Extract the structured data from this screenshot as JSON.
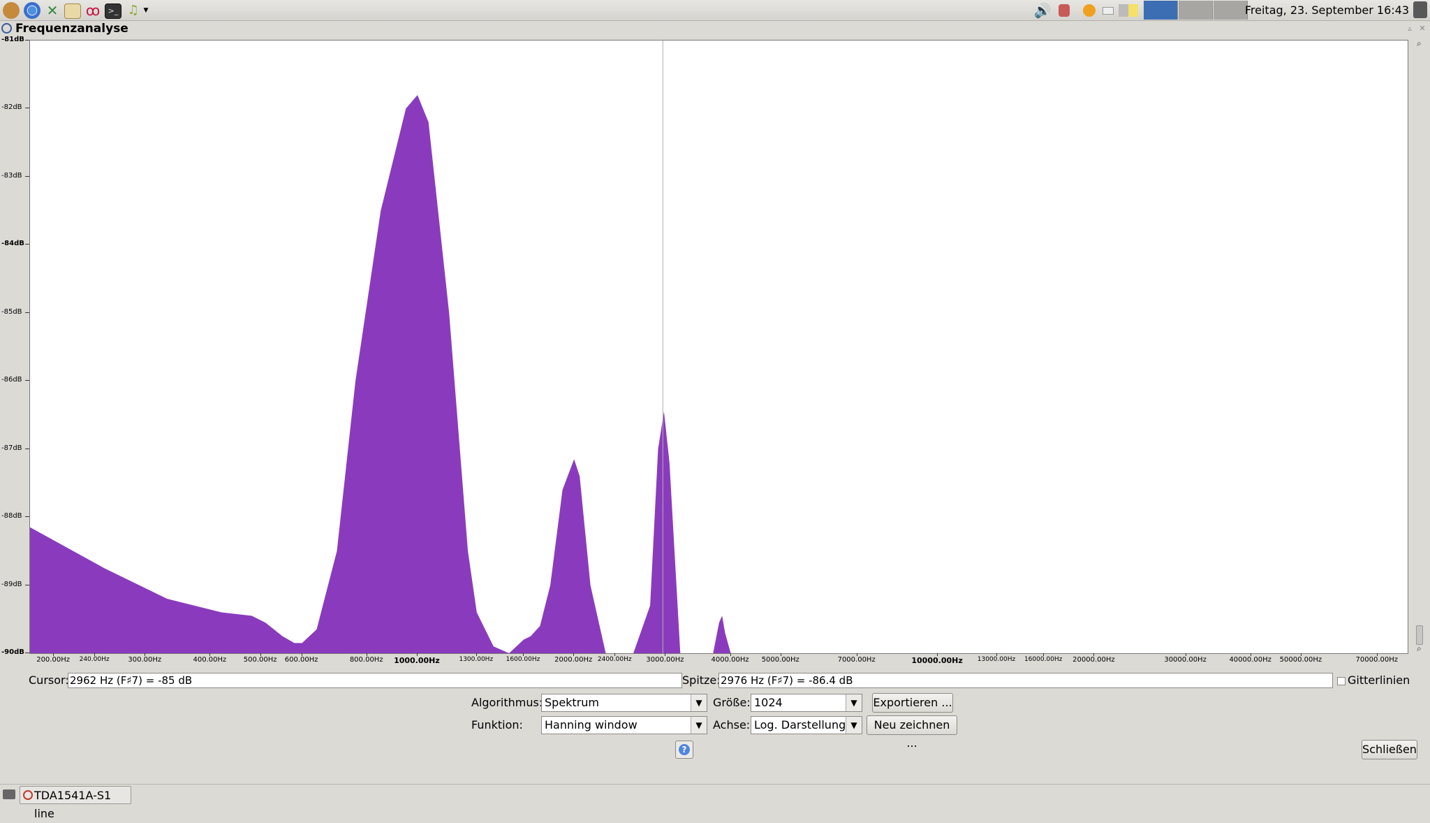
{
  "top_panel": {
    "launchers": [
      "monkey-app-icon",
      "chromium-icon",
      "tools-icon",
      "text-editor-icon",
      "debian-icon",
      "terminal-icon",
      "music-icon"
    ],
    "clock": "Freitag, 23. September 16:43"
  },
  "window": {
    "title": "Frequenzanalyse"
  },
  "chart_data": {
    "type": "area",
    "color": "#8a3bbd",
    "x_scale": "log",
    "xlim": [
      180,
      80000
    ],
    "ylim": [
      -90,
      -81
    ],
    "y_ticks": [
      "-81dB",
      "-82dB",
      "-83dB",
      "-84dB",
      "-85dB",
      "-86dB",
      "-87dB",
      "-88dB",
      "-89dB",
      "-90dB"
    ],
    "x_ticks": [
      "200.00Hz",
      "240.00Hz",
      "300.00Hz",
      "400.00Hz",
      "500.00Hz",
      "600.00Hz",
      "800.00Hz",
      "1000.00Hz",
      "1300.00Hz",
      "1600.00Hz",
      "2000.00Hz",
      "2400.00Hz",
      "3000.00Hz",
      "4000.00Hz",
      "5000.00Hz",
      "7000.00Hz",
      "10000.00Hz",
      "13000.00Hz",
      "16000.00Hz",
      "20000.00Hz",
      "30000.00Hz",
      "40000.00Hz",
      "50000.00Hz",
      "70000.00Hz"
    ],
    "x": [
      180,
      250,
      330,
      420,
      480,
      510,
      550,
      580,
      600,
      640,
      700,
      760,
      850,
      950,
      1000,
      1050,
      1150,
      1250,
      1300,
      1400,
      1500,
      1600,
      1650,
      1720,
      1800,
      1900,
      2000,
      2050,
      2150,
      2300,
      2400,
      2600,
      2800,
      2900,
      2976,
      3050,
      3200,
      3300,
      3500,
      3700,
      3800,
      3850,
      3900,
      4000,
      80000
    ],
    "y": [
      -88.15,
      -88.75,
      -89.2,
      -89.4,
      -89.45,
      -89.55,
      -89.75,
      -89.85,
      -89.85,
      -89.65,
      -88.5,
      -86.0,
      -83.5,
      -82.0,
      -81.8,
      -82.2,
      -85.0,
      -88.5,
      -89.4,
      -89.9,
      -90.0,
      -89.8,
      -89.75,
      -89.6,
      -89.0,
      -87.6,
      -87.15,
      -87.4,
      -89.0,
      -90.0,
      -90.0,
      -90.0,
      -89.3,
      -87.0,
      -86.45,
      -87.2,
      -90.0,
      -90.0,
      -90.0,
      -90.0,
      -89.55,
      -89.45,
      -89.7,
      -90.0,
      -90.0
    ],
    "cursor_x": 2962,
    "grid": false
  },
  "info": {
    "cursor_label": "Cursor:",
    "cursor_value": "2962 Hz (F♯7) = -85 dB",
    "peak_label": "Spitze:",
    "peak_value": "2976 Hz (F♯7) = -86.4 dB",
    "grid_label": "Gitterlinien"
  },
  "controls": {
    "algorithm_label": "Algorithmus:",
    "algorithm_value": "Spektrum",
    "size_label": "Größe:",
    "size_value": "1024",
    "export_button": "Exportieren ...",
    "function_label": "Funktion:",
    "function_value": "Hanning window",
    "axis_label": "Achse:",
    "axis_value": "Log. Darstellung",
    "replot_button": "Neu zeichnen ...",
    "help_symbol": "?",
    "close_button": "Schließen"
  },
  "taskbar": {
    "task_label": "TDA1541A-S1 line"
  }
}
